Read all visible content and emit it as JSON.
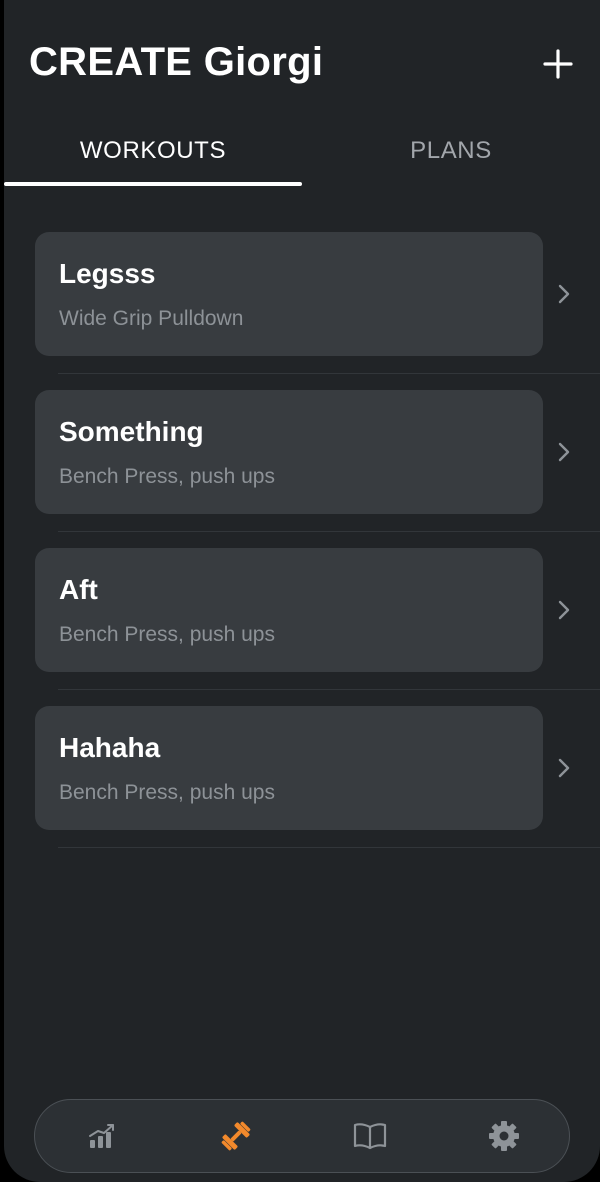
{
  "header": {
    "title": "CREATE Giorgi",
    "add_icon": "plus-icon"
  },
  "tabs": [
    {
      "label": "WORKOUTS",
      "active": true
    },
    {
      "label": "PLANS",
      "active": false
    }
  ],
  "workouts": [
    {
      "title": "Legsss",
      "subtitle": "Wide Grip Pulldown"
    },
    {
      "title": "Something",
      "subtitle": "Bench Press, push ups"
    },
    {
      "title": "Aft",
      "subtitle": "Bench Press, push ups"
    },
    {
      "title": "Hahaha",
      "subtitle": "Bench Press, push ups"
    }
  ],
  "bottom_nav": [
    {
      "icon": "stats-icon",
      "active": false
    },
    {
      "icon": "dumbbell-icon",
      "active": true
    },
    {
      "icon": "book-icon",
      "active": false
    },
    {
      "icon": "gear-icon",
      "active": false
    }
  ],
  "colors": {
    "background": "#212427",
    "card": "#383c40",
    "accent": "#f2892c",
    "inactive_icon": "#8e9398",
    "subtitle": "#8d9297"
  }
}
